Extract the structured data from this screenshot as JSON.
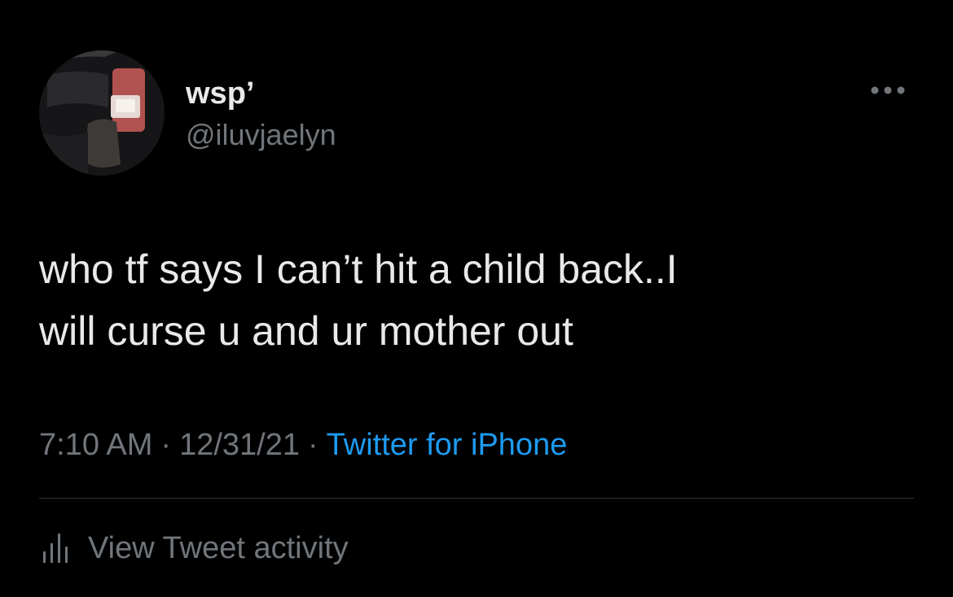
{
  "tweet": {
    "author": {
      "display_name": "wsp’",
      "handle": "@iluvjaelyn",
      "avatar_icon": "profile-photo-avatar"
    },
    "text": "who tf says I can’t hit a child back..I\nwill curse u and ur mother out",
    "time": "7:10 AM",
    "date": "12/31/21",
    "separator": "·",
    "source": "Twitter for iPhone",
    "more_icon": "more-options-icon"
  },
  "footer": {
    "activity_label": "View Tweet activity",
    "activity_icon": "bar-chart-icon"
  },
  "colors": {
    "background": "#000000",
    "primary_text": "#e7e9ea",
    "secondary_text": "#71767b",
    "link": "#1d9bf0",
    "divider": "#2f3336"
  }
}
